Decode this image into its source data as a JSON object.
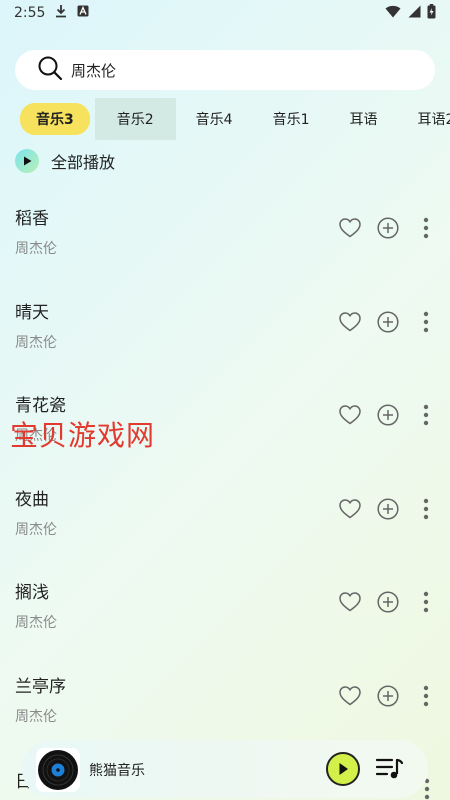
{
  "status": {
    "time": "2:55"
  },
  "search": {
    "query": "周杰伦"
  },
  "tabs": [
    {
      "label": "音乐3",
      "state": "selected"
    },
    {
      "label": "音乐2",
      "state": "pressed"
    },
    {
      "label": "音乐4"
    },
    {
      "label": "音乐1"
    },
    {
      "label": "耳语"
    },
    {
      "label": "耳语2"
    }
  ],
  "play_all": {
    "label": "全部播放"
  },
  "songs": [
    {
      "title": "稻香",
      "artist": "周杰伦"
    },
    {
      "title": "晴天",
      "artist": "周杰伦"
    },
    {
      "title": "青花瓷",
      "artist": "周杰伦"
    },
    {
      "title": "夜曲",
      "artist": "周杰伦"
    },
    {
      "title": "搁浅",
      "artist": "周杰伦"
    },
    {
      "title": "兰亭序",
      "artist": "周杰伦"
    }
  ],
  "peek_song": {
    "title": "日"
  },
  "watermark": "宝贝游戏网",
  "player": {
    "title": "熊猫音乐"
  },
  "colors": {
    "accent": "#f6e25c",
    "play": "#d3f04a",
    "tab_pressed": "#d3e9e4"
  }
}
